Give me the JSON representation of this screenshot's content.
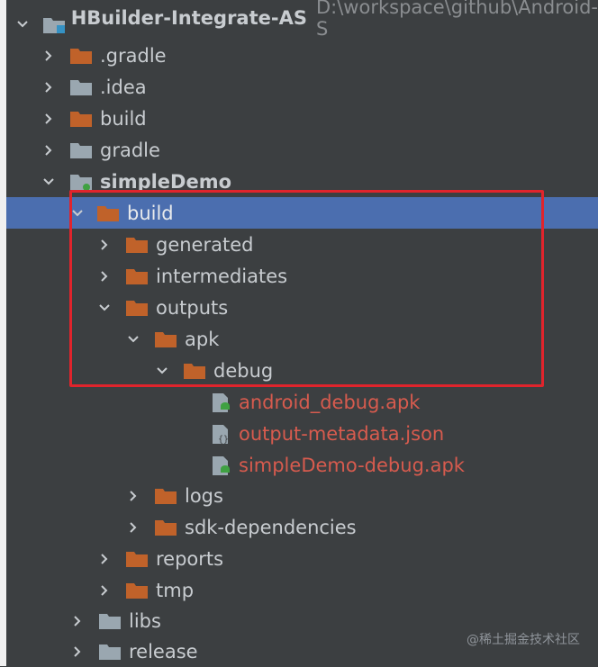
{
  "project": {
    "name": "HBuilder-Integrate-AS",
    "path": "D:\\workspace\\github\\Android-S"
  },
  "tree": [
    {
      "label": ".gradle",
      "expanded": false,
      "icon": "folder-orange"
    },
    {
      "label": ".idea",
      "expanded": false,
      "icon": "folder-gray"
    },
    {
      "label": "build",
      "expanded": false,
      "icon": "folder-orange"
    },
    {
      "label": "gradle",
      "expanded": false,
      "icon": "folder-gray"
    },
    {
      "label": "simpleDemo",
      "expanded": true,
      "icon": "module-folder"
    },
    {
      "label": "build",
      "expanded": true,
      "icon": "folder-orange",
      "selected": true
    },
    {
      "label": "generated",
      "expanded": false,
      "icon": "folder-orange"
    },
    {
      "label": "intermediates",
      "expanded": false,
      "icon": "folder-orange"
    },
    {
      "label": "outputs",
      "expanded": true,
      "icon": "folder-orange"
    },
    {
      "label": "apk",
      "expanded": true,
      "icon": "folder-orange"
    },
    {
      "label": "debug",
      "expanded": true,
      "icon": "folder-orange"
    },
    {
      "label": "android_debug.apk",
      "icon": "apk-file"
    },
    {
      "label": "output-metadata.json",
      "icon": "json-file"
    },
    {
      "label": "simpleDemo-debug.apk",
      "icon": "apk-file"
    },
    {
      "label": "logs",
      "expanded": false,
      "icon": "folder-orange"
    },
    {
      "label": "sdk-dependencies",
      "expanded": false,
      "icon": "folder-orange"
    },
    {
      "label": "reports",
      "expanded": false,
      "icon": "folder-orange"
    },
    {
      "label": "tmp",
      "expanded": false,
      "icon": "folder-orange"
    },
    {
      "label": "libs",
      "expanded": false,
      "icon": "folder-gray"
    },
    {
      "label": "release",
      "expanded": false,
      "icon": "folder-gray"
    }
  ],
  "watermark": "@稀土掘金技术社区",
  "colors": {
    "background": "#3c3f41",
    "selection": "#4b6eaf",
    "folder_orange": "#c0622a",
    "folder_gray": "#9aa7b0",
    "file_text": "#d75b4e",
    "highlight_border": "#e0242c"
  }
}
